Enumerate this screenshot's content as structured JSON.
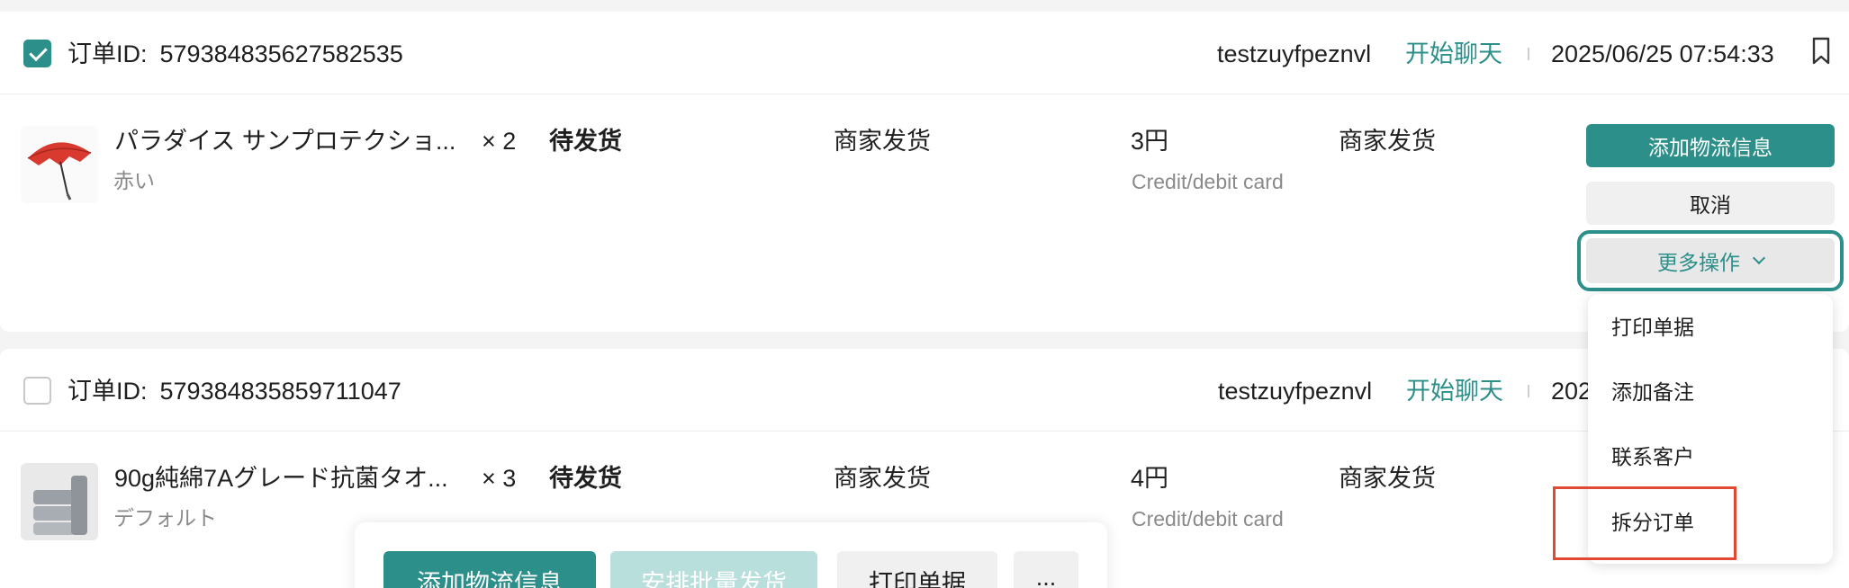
{
  "orders": [
    {
      "checked": true,
      "order_id_label": "订单ID:",
      "order_id": "579384835627582535",
      "buyer": "testzuyfpeznvl",
      "chat_label": "开始聊天",
      "date": "2025/06/25 07:54:33",
      "product_name": "パラダイス サンプロテクショ...",
      "quantity": "× 2",
      "variant": "赤い",
      "status": "待发货",
      "shipping": "商家发货",
      "price": "3円",
      "payment": "Credit/debit card",
      "shipping2": "商家发货",
      "actions": {
        "add_logistics": "添加物流信息",
        "cancel": "取消",
        "more": "更多操作"
      }
    },
    {
      "checked": false,
      "order_id_label": "订单ID:",
      "order_id": "579384835859711047",
      "buyer": "testzuyfpeznvl",
      "chat_label": "开始聊天",
      "date_visible": "202",
      "product_name": "90g純綿7Aグレード抗菌タオ...",
      "quantity": "× 3",
      "variant": "デフォルト",
      "status": "待发货",
      "shipping": "商家发货",
      "price": "4円",
      "payment": "Credit/debit card",
      "shipping2": "商家发货"
    }
  ],
  "more_menu": {
    "items": [
      "打印单据",
      "添加备注",
      "联系客户",
      "拆分订单"
    ],
    "highlighted": "拆分订单"
  },
  "bulk_bar": {
    "add_logistics": "添加物流信息",
    "batch_ship": "安排批量发货",
    "print": "打印单据",
    "more": "..."
  },
  "colors": {
    "accent": "#2c8f8a",
    "highlight_box": "#e04a32",
    "muted_text": "#8a8a8a"
  },
  "icons": [
    "checkbox-checked-icon",
    "checkbox-empty-icon",
    "bookmark-icon",
    "chevron-down-icon"
  ]
}
